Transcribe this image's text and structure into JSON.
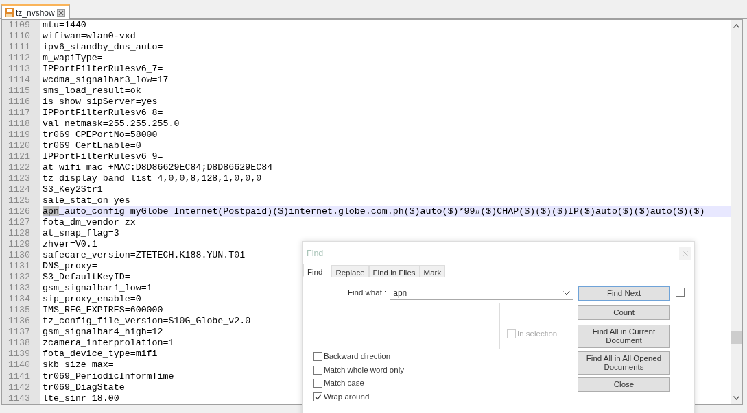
{
  "document_tabs": [
    {
      "label": "tz_nvshow",
      "selected": true
    }
  ],
  "editor": {
    "lines": [
      {
        "number": "1109",
        "text": "mtu=1440",
        "current": false
      },
      {
        "number": "1110",
        "text": "wifiwan=wlan0-vxd",
        "current": false
      },
      {
        "number": "1111",
        "text": "ipv6_standby_dns_auto=",
        "current": false
      },
      {
        "number": "1112",
        "text": "m_wapiType=",
        "current": false
      },
      {
        "number": "1113",
        "text": "IPPortFilterRulesv6_7=",
        "current": false
      },
      {
        "number": "1114",
        "text": "wcdma_signalbar3_low=17",
        "current": false
      },
      {
        "number": "1115",
        "text": "sms_load_result=ok",
        "current": false
      },
      {
        "number": "1116",
        "text": "is_show_sipServer=yes",
        "current": false
      },
      {
        "number": "1117",
        "text": "IPPortFilterRulesv6_8=",
        "current": false
      },
      {
        "number": "1118",
        "text": "val_netmask=255.255.255.0",
        "current": false
      },
      {
        "number": "1119",
        "text": "tr069_CPEPortNo=58000",
        "current": false
      },
      {
        "number": "1120",
        "text": "tr069_CertEnable=0",
        "current": false
      },
      {
        "number": "1121",
        "text": "IPPortFilterRulesv6_9=",
        "current": false
      },
      {
        "number": "1122",
        "text": "at_wifi_mac=+MAC:D8D86629EC84;D8D86629EC84",
        "current": false
      },
      {
        "number": "1123",
        "text": "tz_display_band_list=4,0,0,8,128,1,0,0,0",
        "current": false
      },
      {
        "number": "1124",
        "text": "S3_Key2Str1=",
        "current": false
      },
      {
        "number": "1125",
        "text": "sale_stat_on=yes",
        "current": false
      },
      {
        "number": "1126",
        "selected_part": "apn",
        "text": "_auto_config=myGlobe Internet(Postpaid)($)internet.globe.com.ph($)auto($)*99#($)CHAP($)($)($)IP($)auto($)($)auto($)($)",
        "current": true
      },
      {
        "number": "1127",
        "text": "fota_dm_vendor=zx",
        "current": false
      },
      {
        "number": "1128",
        "text": "at_snap_flag=3",
        "current": false
      },
      {
        "number": "1129",
        "text": "zhver=V0.1",
        "current": false
      },
      {
        "number": "1130",
        "text": "safecare_version=ZTETECH.K188.YUN.T01",
        "current": false
      },
      {
        "number": "1131",
        "text": "DNS_proxy=",
        "current": false
      },
      {
        "number": "1132",
        "text": "S3_DefaultKeyID=",
        "current": false
      },
      {
        "number": "1133",
        "text": "gsm_signalbar1_low=1",
        "current": false
      },
      {
        "number": "1134",
        "text": "sip_proxy_enable=0",
        "current": false
      },
      {
        "number": "1135",
        "text": "IMS_REG_EXPIRES=600000",
        "current": false
      },
      {
        "number": "1136",
        "text": "tz_config_file_version=S10G_Globe_v2.0",
        "current": false
      },
      {
        "number": "1137",
        "text": "gsm_signalbar4_high=12",
        "current": false
      },
      {
        "number": "1138",
        "text": "zcamera_interprolation=1",
        "current": false
      },
      {
        "number": "1139",
        "text": "fota_device_type=mifi",
        "current": false
      },
      {
        "number": "1140",
        "text": "skb_size_max=",
        "current": false
      },
      {
        "number": "1141",
        "text": "tr069_PeriodicInformTime=",
        "current": false
      },
      {
        "number": "1142",
        "text": "tr069_DiagState=",
        "current": false
      },
      {
        "number": "1143",
        "text": "lte_sinr=18.00",
        "current": false
      }
    ]
  },
  "find_dialog": {
    "title": "Find",
    "active": false,
    "tabs": [
      {
        "label": "Find",
        "selected": true
      },
      {
        "label": "Replace",
        "selected": false
      },
      {
        "label": "Find in Files",
        "selected": false
      },
      {
        "label": "Mark",
        "selected": false
      }
    ],
    "find_what": {
      "label": "Find what :",
      "value": "apn"
    },
    "side_checkbox": {
      "checked": false
    },
    "in_selection": {
      "label": "In selection",
      "checked": false,
      "disabled": true
    },
    "options": [
      {
        "label": "Backward direction",
        "checked": false
      },
      {
        "label": "Match whole word only",
        "checked": false
      },
      {
        "label": "Match case",
        "checked": false
      },
      {
        "label": "Wrap around",
        "checked": true
      }
    ],
    "buttons": [
      {
        "label": "Find Next",
        "default": true
      },
      {
        "label": "Count",
        "default": false
      },
      {
        "label": "Find All in Current Document",
        "default": false
      },
      {
        "label": "Find All in All Opened Documents",
        "default": false
      },
      {
        "label": "Close",
        "default": false
      }
    ]
  }
}
